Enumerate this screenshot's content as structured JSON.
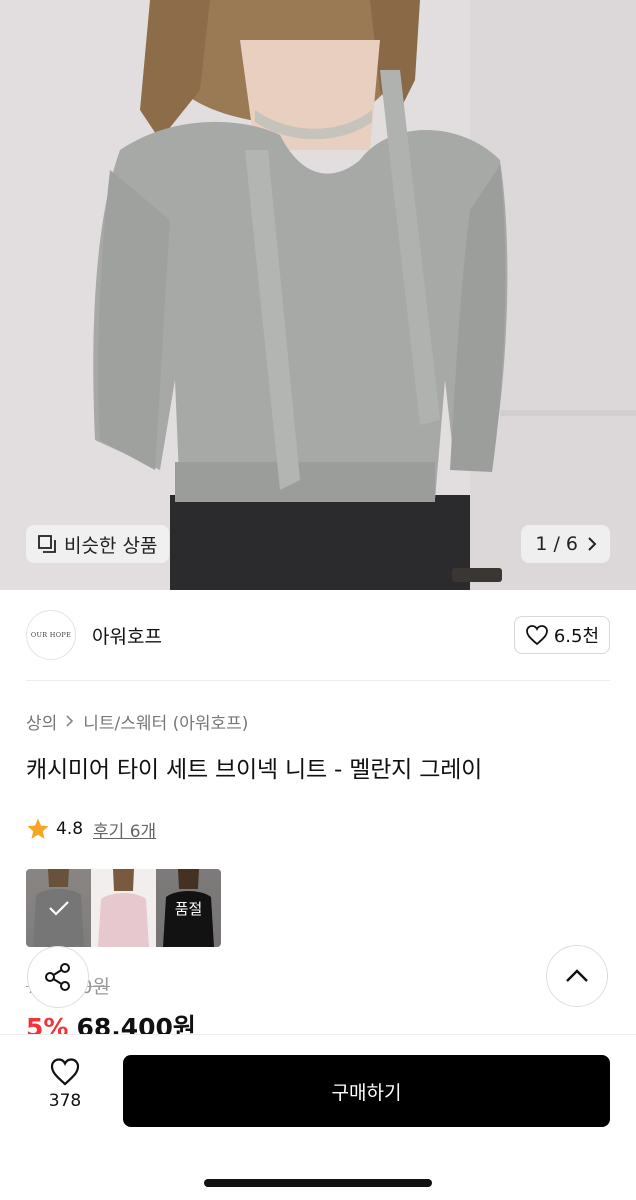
{
  "hero": {
    "similar_label": "비슷한 상품",
    "page_indicator": "1 / 6"
  },
  "brand": {
    "logo_text": "OUR HOPE",
    "name": "아워호프",
    "like_count": "6.5천"
  },
  "breadcrumb": {
    "category": "상의",
    "subcategory": "니트/스웨터 (아워호프)"
  },
  "product": {
    "title": "캐시미어 타이 세트 브이넥 니트 - 멜란지 그레이",
    "rating": "4.8",
    "review_label": "후기 6개",
    "original_price": "72,000원",
    "discount": "5%",
    "price": "68,400원"
  },
  "options": [
    {
      "name": "grey",
      "selected": true,
      "label": ""
    },
    {
      "name": "pink",
      "selected": false,
      "label": ""
    },
    {
      "name": "black",
      "selected": false,
      "label": "품절"
    }
  ],
  "bottom_bar": {
    "wish_count": "378",
    "buy_label": "구매하기"
  },
  "colors": {
    "accent_discount": "#f0343a",
    "rating_star": "#f5a623",
    "buy_button": "#000000"
  }
}
